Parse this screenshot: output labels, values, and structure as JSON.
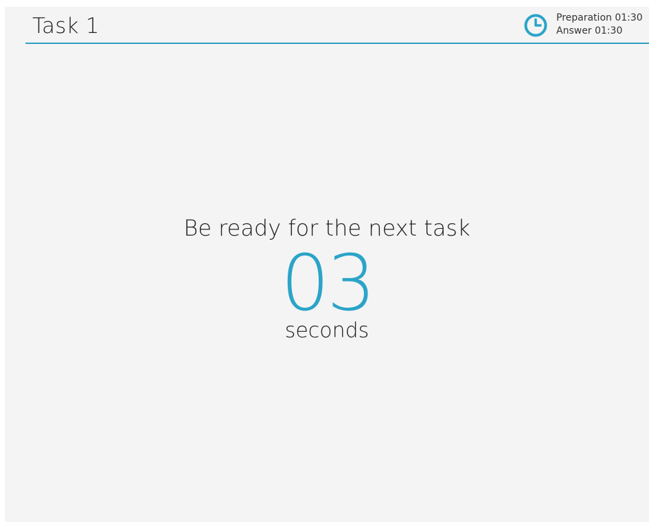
{
  "header": {
    "title": "Task 1",
    "timer": {
      "icon": "clock-icon",
      "preparation": "Preparation 01:30",
      "answer": "Answer 01:30"
    }
  },
  "main": {
    "message": "Be ready for the next task",
    "countdown": "03",
    "unit": "seconds"
  },
  "colors": {
    "accent": "#2ba4c8",
    "background": "#f4f4f4",
    "text": "#222222"
  }
}
